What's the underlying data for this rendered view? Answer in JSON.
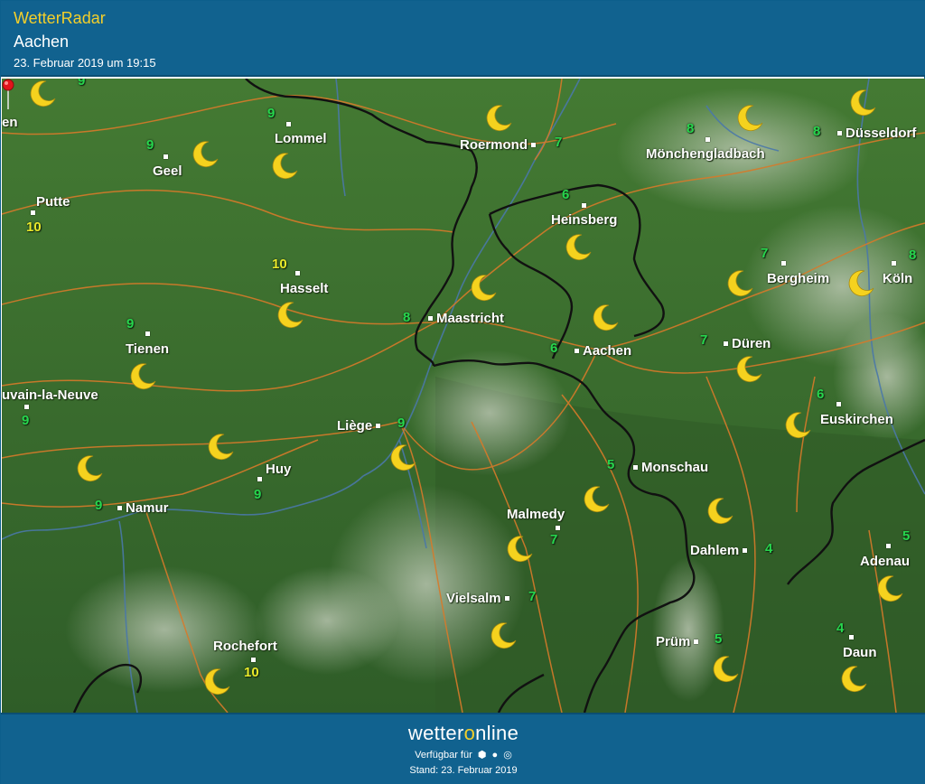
{
  "header": {
    "brand": "WetterRadar",
    "location": "Aachen",
    "timestamp": "23. Februar 2019 um 19:15"
  },
  "map": {
    "places": [
      {
        "id": "lommel",
        "name": "Lommel"
      },
      {
        "id": "geel",
        "name": "Geel"
      },
      {
        "id": "putte",
        "name": "Putte"
      },
      {
        "id": "roermond",
        "name": "Roermond"
      },
      {
        "id": "moenchengladbach",
        "name": "Mönchengladbach"
      },
      {
        "id": "duesseldorf",
        "name": "Düsseldorf"
      },
      {
        "id": "heinsberg",
        "name": "Heinsberg"
      },
      {
        "id": "hasselt",
        "name": "Hasselt"
      },
      {
        "id": "maastricht",
        "name": "Maastricht"
      },
      {
        "id": "bergheim",
        "name": "Bergheim"
      },
      {
        "id": "koeln",
        "name": "Köln"
      },
      {
        "id": "tienen",
        "name": "Tienen"
      },
      {
        "id": "aachen",
        "name": "Aachen"
      },
      {
        "id": "dueren",
        "name": "Düren"
      },
      {
        "id": "louvain",
        "name": "uvain-la-Neuve"
      },
      {
        "id": "euskirchen",
        "name": "Euskirchen"
      },
      {
        "id": "liege",
        "name": "Liège"
      },
      {
        "id": "huy",
        "name": "Huy"
      },
      {
        "id": "monschau",
        "name": "Monschau"
      },
      {
        "id": "namur",
        "name": "Namur"
      },
      {
        "id": "malmedy",
        "name": "Malmedy"
      },
      {
        "id": "dahlem",
        "name": "Dahlem"
      },
      {
        "id": "adenau",
        "name": "Adenau"
      },
      {
        "id": "vielsalm",
        "name": "Vielsalm"
      },
      {
        "id": "rochefort",
        "name": "Rochefort"
      },
      {
        "id": "pruem",
        "name": "Prüm"
      },
      {
        "id": "daun",
        "name": "Daun"
      },
      {
        "id": "en",
        "name": "en"
      }
    ],
    "temperatures": [
      {
        "id": "t-top-left",
        "value": "9",
        "color": "green"
      },
      {
        "id": "t-lommel",
        "value": "9",
        "color": "green"
      },
      {
        "id": "t-geel",
        "value": "9",
        "color": "green"
      },
      {
        "id": "t-putte",
        "value": "10",
        "color": "yellow"
      },
      {
        "id": "t-roermond",
        "value": "7",
        "color": "green"
      },
      {
        "id": "t-moenchengladbach",
        "value": "8",
        "color": "green"
      },
      {
        "id": "t-duesseldorf",
        "value": "8",
        "color": "green"
      },
      {
        "id": "t-heinsberg",
        "value": "6",
        "color": "green"
      },
      {
        "id": "t-hasselt",
        "value": "10",
        "color": "yellow"
      },
      {
        "id": "t-bergheim",
        "value": "7",
        "color": "green"
      },
      {
        "id": "t-koeln",
        "value": "8",
        "color": "green"
      },
      {
        "id": "t-maastricht",
        "value": "8",
        "color": "green"
      },
      {
        "id": "t-tienen",
        "value": "9",
        "color": "green"
      },
      {
        "id": "t-aachen",
        "value": "6",
        "color": "green"
      },
      {
        "id": "t-dueren",
        "value": "7",
        "color": "green"
      },
      {
        "id": "t-louvain",
        "value": "9",
        "color": "green"
      },
      {
        "id": "t-euskirchen",
        "value": "6",
        "color": "green"
      },
      {
        "id": "t-liege",
        "value": "9",
        "color": "green"
      },
      {
        "id": "t-monschau",
        "value": "5",
        "color": "green"
      },
      {
        "id": "t-huy",
        "value": "9",
        "color": "green"
      },
      {
        "id": "t-namur",
        "value": "9",
        "color": "green"
      },
      {
        "id": "t-malmedy",
        "value": "7",
        "color": "green"
      },
      {
        "id": "t-dahlem",
        "value": "4",
        "color": "green"
      },
      {
        "id": "t-adenau",
        "value": "5",
        "color": "green"
      },
      {
        "id": "t-vielsalm",
        "value": "7",
        "color": "green"
      },
      {
        "id": "t-daun",
        "value": "4",
        "color": "green"
      },
      {
        "id": "t-pruem",
        "value": "5",
        "color": "green"
      },
      {
        "id": "t-rochefort",
        "value": "10",
        "color": "yellow"
      }
    ],
    "weather_icon": "crescent-moon-icon",
    "marker_icon": "location-pin-icon",
    "colors": {
      "land": "#3f7330",
      "roads": "#d77a2a",
      "rivers": "#4a78a8",
      "borders": "#111111",
      "temp_green": "#27d64d",
      "temp_yellow": "#e9e92a",
      "moon": "#f5d21e",
      "header_bg": "#11628f",
      "brand_yellow": "#f4cf2a"
    }
  },
  "footer": {
    "logo_part1": "wetter",
    "logo_part2": "o",
    "logo_part3": "nline",
    "available_label": "Verfügbar für",
    "platforms": [
      "android-icon",
      "apple-icon",
      "web-icon"
    ],
    "stand": "Stand: 23. Februar 2019"
  }
}
